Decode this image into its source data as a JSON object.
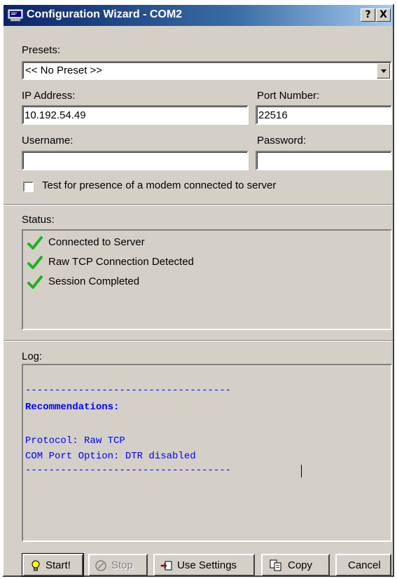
{
  "window": {
    "title": "Configuration Wizard - COM2",
    "help_button": "?",
    "close_button": "X",
    "icon": "terminal-icon"
  },
  "presets": {
    "label": "Presets:",
    "selected": "<< No Preset >>"
  },
  "ip": {
    "label": "IP Address:",
    "value": "10.192.54.49"
  },
  "port": {
    "label": "Port Number:",
    "value": "22516"
  },
  "username": {
    "label": "Username:",
    "value": ""
  },
  "password": {
    "label": "Password:",
    "value": ""
  },
  "modem_check": {
    "label": "Test for presence of a modem connected to server",
    "checked": false
  },
  "status": {
    "label": "Status:",
    "items": [
      {
        "text": "Connected to Server",
        "icon": "checkmark-icon"
      },
      {
        "text": "Raw TCP Connection Detected",
        "icon": "checkmark-icon"
      },
      {
        "text": "Session Completed",
        "icon": "checkmark-icon"
      }
    ]
  },
  "log": {
    "label": "Log:",
    "lines": [
      "-----------------------------------",
      "Recommendations:",
      "",
      "Protocol: Raw TCP",
      "COM Port Option: DTR disabled",
      "-----------------------------------"
    ]
  },
  "buttons": {
    "start": "Start!",
    "stop": "Stop",
    "use_settings": "Use Settings",
    "copy": "Copy",
    "cancel": "Cancel"
  },
  "colors": {
    "titlebar": "#0a246a",
    "log_text": "#0000ff",
    "check": "#22b022",
    "face": "#d4d0c8"
  }
}
